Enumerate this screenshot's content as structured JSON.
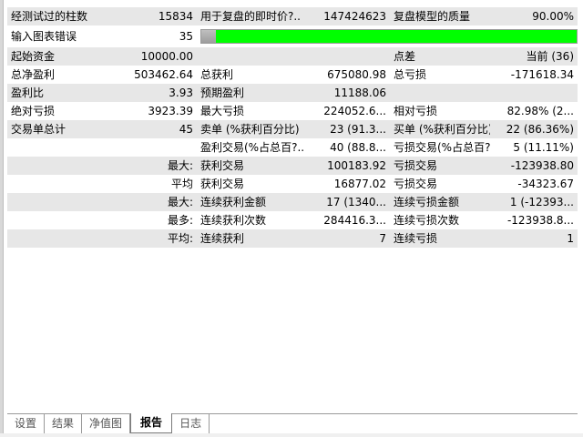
{
  "report": {
    "row1": {
      "bars_label": "经测试过的柱数",
      "bars_value": "15834",
      "ticks_label": "用于复盘的即时价?..",
      "ticks_value": "147424623",
      "quality_label": "复盘模型的质量",
      "quality_value": "90.00%"
    },
    "row2": {
      "errors_label": "输入图表错误",
      "errors_value": "35",
      "quality_fill_percent": 96
    },
    "row3": {
      "deposit_label": "起始资金",
      "deposit_value": "10000.00",
      "spread_label": "点差",
      "spread_value": "当前 (36)"
    },
    "row4": {
      "net_profit_label": "总净盈利",
      "net_profit_value": "503462.64",
      "gross_profit_label": "总获利",
      "gross_profit_value": "675080.98",
      "gross_loss_label": "总亏损",
      "gross_loss_value": "-171618.34"
    },
    "row5": {
      "profit_factor_label": "盈利比",
      "profit_factor_value": "3.93",
      "expected_payoff_label": "预期盈利",
      "expected_payoff_value": "11188.06"
    },
    "row6": {
      "abs_drawdown_label": "绝对亏损",
      "abs_drawdown_value": "3923.39",
      "max_drawdown_label": "最大亏损",
      "max_drawdown_value": "224052.6...",
      "rel_drawdown_label": "相对亏损",
      "rel_drawdown_value": "82.98% (2..."
    },
    "row7": {
      "total_trades_label": "交易单总计",
      "total_trades_value": "45",
      "short_label": "卖单 (%获利百分比)",
      "short_value": "23 (91.3...",
      "long_label": "买单 (%获利百分比)",
      "long_value": "22 (86.36%)"
    },
    "row8": {
      "profit_trades_label": "盈利交易(%占总百?..",
      "profit_trades_value": "40 (88.8...",
      "loss_trades_label": "亏损交易(%占总百?..",
      "loss_trades_value": "5 (11.11%)"
    },
    "row9": {
      "prefix": "最大:",
      "largest_profit_label": "获利交易",
      "largest_profit_value": "100183.92",
      "largest_loss_label": "亏损交易",
      "largest_loss_value": "-123938.80"
    },
    "row10": {
      "prefix": "平均",
      "avg_profit_label": "获利交易",
      "avg_profit_value": "16877.02",
      "avg_loss_label": "亏损交易",
      "avg_loss_value": "-34323.67"
    },
    "row11": {
      "prefix": "最大:",
      "max_consec_wins_label": "连续获利金额",
      "max_consec_wins_value": "17 (1340...",
      "max_consec_losses_label": "连续亏损金额",
      "max_consec_losses_value": "1 (-12393..."
    },
    "row12": {
      "prefix": "最多:",
      "max_consec_profit_label": "连续获利次数",
      "max_consec_profit_value": "284416.3...",
      "max_consec_loss_label": "连续亏损次数",
      "max_consec_loss_value": "-123938.8..."
    },
    "row13": {
      "prefix": "平均:",
      "avg_consec_wins_label": "连续获利",
      "avg_consec_wins_value": "7",
      "avg_consec_losses_label": "连续亏损",
      "avg_consec_losses_value": "1"
    }
  },
  "tabs": [
    {
      "label": "设置"
    },
    {
      "label": "结果"
    },
    {
      "label": "净值图"
    },
    {
      "label": "报告"
    },
    {
      "label": "日志"
    }
  ],
  "active_tab": "报告",
  "colors": {
    "quality_bar": "#00ff00",
    "row_shade": "#e7e7e7"
  }
}
